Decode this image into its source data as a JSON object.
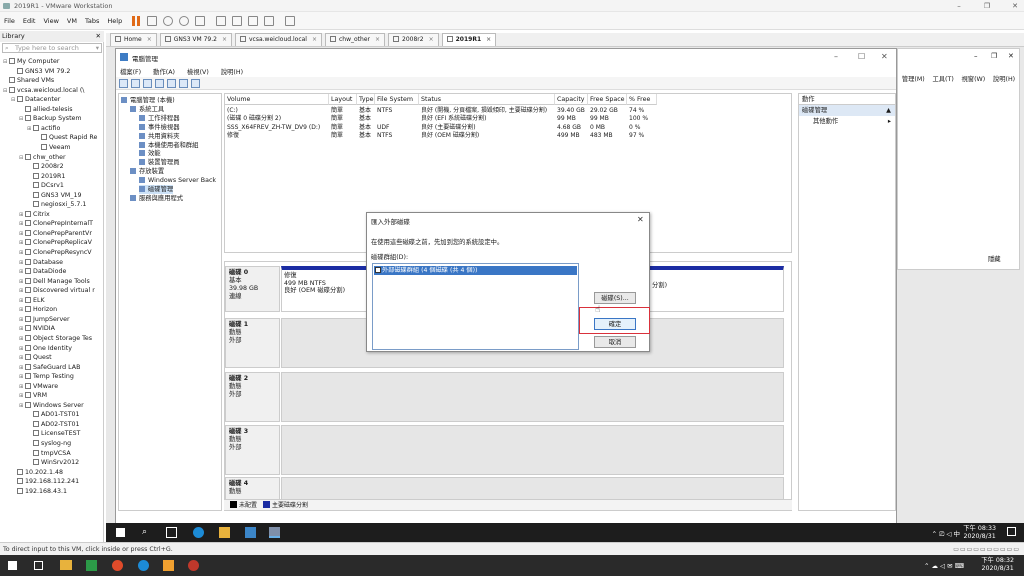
{
  "window": {
    "title": "2019R1 - VMware Workstation",
    "controls": [
      "–",
      "❐",
      "✕"
    ]
  },
  "menu": {
    "items": [
      "File",
      "Edit",
      "View",
      "VM",
      "Tabs",
      "Help"
    ]
  },
  "library": {
    "title": "Library",
    "search_placeholder": "Type here to search",
    "items": [
      {
        "label": "My Computer",
        "lvl": 0,
        "ex": "⊟"
      },
      {
        "label": "GNS3 VM 79.2",
        "lvl": 1,
        "ex": ""
      },
      {
        "label": "Shared VMs",
        "lvl": 0,
        "ex": ""
      },
      {
        "label": "vcsa.weicloud.local (\\ ",
        "lvl": 0,
        "ex": "⊟"
      },
      {
        "label": "Datacenter",
        "lvl": 1,
        "ex": "⊟"
      },
      {
        "label": "allied-telesis",
        "lvl": 2,
        "ex": ""
      },
      {
        "label": "Backup System",
        "lvl": 2,
        "ex": "⊟"
      },
      {
        "label": "actifio",
        "lvl": 3,
        "ex": "⊞"
      },
      {
        "label": "Quest Rapid Re",
        "lvl": 4,
        "ex": ""
      },
      {
        "label": "Veeam",
        "lvl": 4,
        "ex": ""
      },
      {
        "label": "chw_other",
        "lvl": 2,
        "ex": "⊟"
      },
      {
        "label": "2008r2",
        "lvl": 3,
        "ex": ""
      },
      {
        "label": "2019R1",
        "lvl": 3,
        "ex": ""
      },
      {
        "label": "DCsrv1",
        "lvl": 3,
        "ex": ""
      },
      {
        "label": "GNS3 VM_19",
        "lvl": 3,
        "ex": ""
      },
      {
        "label": "negiosxi_5.7.1",
        "lvl": 3,
        "ex": ""
      },
      {
        "label": "Citrix",
        "lvl": 2,
        "ex": "⊞"
      },
      {
        "label": "ClonePrepInternalT",
        "lvl": 2,
        "ex": "⊞"
      },
      {
        "label": "ClonePrepParentVr",
        "lvl": 2,
        "ex": "⊞"
      },
      {
        "label": "ClonePrepReplicaV",
        "lvl": 2,
        "ex": "⊞"
      },
      {
        "label": "ClonePrepResyncV",
        "lvl": 2,
        "ex": "⊞"
      },
      {
        "label": "Database",
        "lvl": 2,
        "ex": "⊞"
      },
      {
        "label": "DataDiode",
        "lvl": 2,
        "ex": "⊞"
      },
      {
        "label": "Dell Manage Tools",
        "lvl": 2,
        "ex": "⊞"
      },
      {
        "label": "Discovered virtual r",
        "lvl": 2,
        "ex": "⊞"
      },
      {
        "label": "ELK",
        "lvl": 2,
        "ex": "⊞"
      },
      {
        "label": "Horizon",
        "lvl": 2,
        "ex": "⊞"
      },
      {
        "label": "JumpServer",
        "lvl": 2,
        "ex": "⊞"
      },
      {
        "label": "NVIDIA",
        "lvl": 2,
        "ex": "⊞"
      },
      {
        "label": "Object Storage Tes",
        "lvl": 2,
        "ex": "⊞"
      },
      {
        "label": "One Identity",
        "lvl": 2,
        "ex": "⊞"
      },
      {
        "label": "Quest",
        "lvl": 2,
        "ex": "⊞"
      },
      {
        "label": "SafeGuard LAB",
        "lvl": 2,
        "ex": "⊞"
      },
      {
        "label": "Temp Testing",
        "lvl": 2,
        "ex": "⊞"
      },
      {
        "label": "VMware",
        "lvl": 2,
        "ex": "⊞"
      },
      {
        "label": "VRM",
        "lvl": 2,
        "ex": "⊞"
      },
      {
        "label": "Windows Server",
        "lvl": 2,
        "ex": "⊞"
      },
      {
        "label": "AD01-TST01",
        "lvl": 3,
        "ex": ""
      },
      {
        "label": "AD02-TST01",
        "lvl": 3,
        "ex": ""
      },
      {
        "label": "LicenseTEST",
        "lvl": 3,
        "ex": ""
      },
      {
        "label": "syslog-ng",
        "lvl": 3,
        "ex": ""
      },
      {
        "label": "tmpVCSA",
        "lvl": 3,
        "ex": ""
      },
      {
        "label": "WinSrv2012",
        "lvl": 3,
        "ex": ""
      },
      {
        "label": "10.202.1.48",
        "lvl": 1,
        "ex": ""
      },
      {
        "label": "192.168.112.241",
        "lvl": 1,
        "ex": ""
      },
      {
        "label": "192.168.43.1",
        "lvl": 1,
        "ex": ""
      }
    ]
  },
  "tabs": [
    {
      "label": "Home"
    },
    {
      "label": "GNS3 VM 79.2"
    },
    {
      "label": "vcsa.weicloud.local"
    },
    {
      "label": "chw_other"
    },
    {
      "label": "2008r2"
    },
    {
      "label": "2019R1"
    }
  ],
  "disk_mgmt": {
    "title": "電腦管理",
    "menu": [
      "檔案(F)",
      "動作(A)",
      "檢視(V)",
      "說明(H)"
    ],
    "tree": [
      {
        "label": "電腦管理 (本機)",
        "lvl": 0
      },
      {
        "label": "系統工具",
        "lvl": 1
      },
      {
        "label": "工作排程器",
        "lvl": 2
      },
      {
        "label": "事件檢視器",
        "lvl": 2
      },
      {
        "label": "共用資料夾",
        "lvl": 2
      },
      {
        "label": "本機使用者和群組",
        "lvl": 2
      },
      {
        "label": "效能",
        "lvl": 2
      },
      {
        "label": "裝置管理員",
        "lvl": 2
      },
      {
        "label": "存放裝置",
        "lvl": 1
      },
      {
        "label": "Windows Server Back",
        "lvl": 2
      },
      {
        "label": "磁碟管理",
        "lvl": 2
      },
      {
        "label": "服務與應用程式",
        "lvl": 1
      }
    ],
    "columns": [
      "Volume",
      "Layout",
      "Type",
      "File System",
      "Status",
      "Capacity",
      "Free Space",
      "% Free"
    ],
    "rows": [
      [
        "(C:)",
        "簡單",
        "基本",
        "NTFS",
        "良好 (開機, 分頁檔案, 損毀傾印, 主要磁碟分割)",
        "39.40 GB",
        "29.02 GB",
        "74 %"
      ],
      [
        "(磁碟 0 磁碟分割 2)",
        "簡單",
        "基本",
        "",
        "良好 (EFI 系統磁碟分割)",
        "99 MB",
        "99 MB",
        "100 %"
      ],
      [
        "SSS_X64FREV_ZH-TW_DV9 (D:)",
        "簡單",
        "基本",
        "UDF",
        "良好 (主要磁碟分割)",
        "4.68 GB",
        "0 MB",
        "0 %"
      ],
      [
        "修復",
        "簡單",
        "基本",
        "NTFS",
        "良好 (OEM 磁碟分割)",
        "499 MB",
        "483 MB",
        "97 %"
      ]
    ],
    "disks": [
      {
        "name": "磁碟 0",
        "kind": "基本",
        "size": "39.98 GB",
        "state": "連線"
      },
      {
        "name": "磁碟 1",
        "kind": "動態",
        "state": "外部"
      },
      {
        "name": "磁碟 2",
        "kind": "動態",
        "state": "外部"
      },
      {
        "name": "磁碟 3",
        "kind": "動態",
        "state": "外部"
      },
      {
        "name": "磁碟 4",
        "kind": "動態"
      }
    ],
    "disk0_part": {
      "name": "修復",
      "size": "499 MB NTFS",
      "status": "良好 (OEM 磁碟分割)"
    },
    "disk0_part_right": "分割)",
    "legend": [
      "未配置",
      "主要磁碟分割"
    ],
    "actions": {
      "header": "動作",
      "sub": "磁碟管理",
      "more": "其他動作"
    }
  },
  "vsphere": {
    "menu": [
      "管理(M)",
      "工具(T)",
      "視窗(W)",
      "說明(H)"
    ],
    "hide": "隱藏"
  },
  "dialog": {
    "title": "匯入外部磁碟",
    "desc": "在使用這些磁碟之前，先加到您的系統設定中。",
    "group_label": "磁碟群組(D):",
    "item": "外部磁碟群組 (4 個磁碟 (共 4 個))",
    "btn_disks": "磁碟(S)...",
    "btn_ok": "確定",
    "btn_cancel": "取消"
  },
  "guest_clock": {
    "time": "下午 08:33",
    "date": "2020/8/31"
  },
  "status_text": "To direct input to this VM, click inside or press Ctrl+G.",
  "host_clock": {
    "time": "下午 08:32",
    "date": "2020/8/31"
  }
}
